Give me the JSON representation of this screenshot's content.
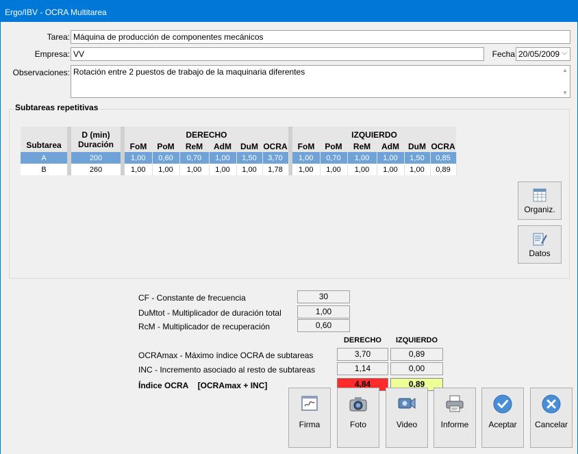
{
  "window": {
    "title": "Ergo/IBV - OCRA Multitarea"
  },
  "form": {
    "tarea_label": "Tarea:",
    "tarea_value": "Máquina de producción de componentes mecánicos",
    "empresa_label": "Empresa:",
    "empresa_value": "VV",
    "fecha_label": "Fecha",
    "fecha_value": "20/05/2009",
    "observaciones_label": "Observaciones:",
    "observaciones_value": "Rotación entre 2 puestos de trabajo de la maquinaria diferentes"
  },
  "subtareas": {
    "title": "Subtareas repetitivas",
    "headers": {
      "subtarea": "Subtarea",
      "duracion_top": "D (min)",
      "duracion_bottom": "Duración",
      "derecho": "DERECHO",
      "izquierdo": "IZQUIERDO",
      "cols": [
        "FoM",
        "PoM",
        "ReM",
        "AdM",
        "DuM",
        "OCRA"
      ]
    },
    "rows": [
      {
        "name": "A",
        "duracion": "200",
        "der": [
          "1,00",
          "0,60",
          "0,70",
          "1,00",
          "1,50",
          "3,70"
        ],
        "izq": [
          "1,00",
          "0,70",
          "1,00",
          "1,00",
          "1,50",
          "0,85"
        ],
        "selected": true
      },
      {
        "name": "B",
        "duracion": "260",
        "der": [
          "1,00",
          "1,00",
          "1,00",
          "1,00",
          "1,00",
          "1,78"
        ],
        "izq": [
          "1,00",
          "1,00",
          "1,00",
          "1,00",
          "1,00",
          "0,89"
        ],
        "selected": false
      }
    ],
    "organiz_label": "Organiz.",
    "datos_label": "Datos"
  },
  "results": {
    "cf_label": "CF - Constante de frecuencia",
    "cf_value": "30",
    "dumtot_label": "DuMtot - Multiplicador de duración total",
    "dumtot_value": "1,00",
    "rcm_label": "RcM - Multiplicador de recuperación",
    "rcm_value": "0,60",
    "derecho_header": "DERECHO",
    "izquierdo_header": "IZQUIERDO",
    "ocramax_label": "OCRAmax - Máximo índice OCRA de subtareas",
    "ocramax_der": "3,70",
    "ocramax_izq": "0,89",
    "inc_label": "INC - Incremento asociado al resto de subtareas",
    "inc_der": "1,14",
    "inc_izq": "0,00",
    "indice_label": "Índice OCRA",
    "indice_formula": "[OCRAmax + INC]",
    "indice_der": "4,84",
    "indice_izq": "0,89",
    "indice_der_color": "#ff2a2a",
    "indice_izq_color": "#eeff99"
  },
  "buttons": {
    "firma": "Firma",
    "foto": "Foto",
    "video": "Video",
    "informe": "Informe",
    "aceptar": "Aceptar",
    "cancelar": "Cancelar"
  }
}
